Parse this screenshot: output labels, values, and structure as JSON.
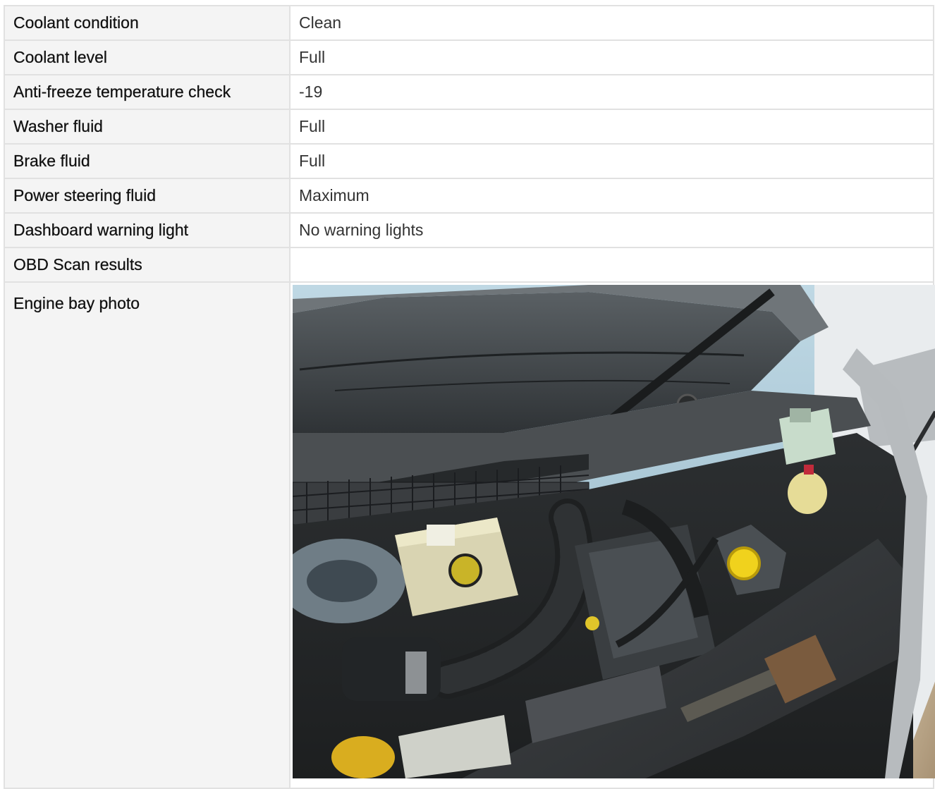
{
  "rows": [
    {
      "label": "Coolant condition",
      "value": "Clean"
    },
    {
      "label": "Coolant level",
      "value": "Full"
    },
    {
      "label": "Anti-freeze temperature check",
      "value": "-19"
    },
    {
      "label": "Washer fluid",
      "value": "Full"
    },
    {
      "label": "Brake fluid",
      "value": "Full"
    },
    {
      "label": "Power steering fluid",
      "value": "Maximum"
    },
    {
      "label": "Dashboard warning light",
      "value": "No warning lights"
    },
    {
      "label": "OBD Scan results",
      "value": ""
    }
  ],
  "photo_row": {
    "label": "Engine bay photo"
  }
}
